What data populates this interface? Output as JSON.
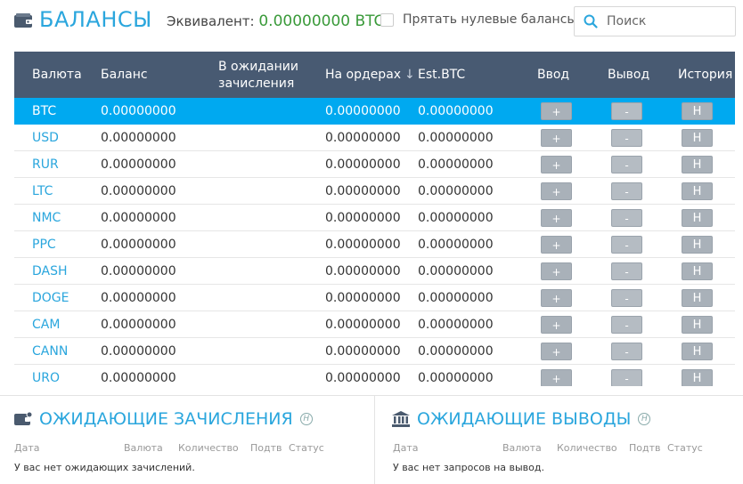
{
  "header": {
    "title": "БАЛАНСЫ",
    "equiv_label": "Эквивалент:",
    "equiv_value": "0.00000000 BTC",
    "hide_zero_label": "Прятать нулевые балансы",
    "search_placeholder": "Поиск"
  },
  "table": {
    "columns": {
      "currency": "Валюта",
      "balance": "Баланс",
      "pending_1": "В ожидании",
      "pending_2": "зачисления",
      "orders": "На ордерах",
      "sort_arrow": "↓",
      "est_btc": "Est.BTC",
      "deposit": "Ввод",
      "withdraw": "Вывод",
      "history": "История"
    },
    "button_labels": {
      "deposit": "+",
      "withdraw": "-",
      "history": "H"
    },
    "rows": [
      {
        "currency": "BTC",
        "balance": "0.00000000",
        "orders": "0.00000000",
        "est_btc": "0.00000000"
      },
      {
        "currency": "USD",
        "balance": "0.00000000",
        "orders": "0.00000000",
        "est_btc": "0.00000000"
      },
      {
        "currency": "RUR",
        "balance": "0.00000000",
        "orders": "0.00000000",
        "est_btc": "0.00000000"
      },
      {
        "currency": "LTC",
        "balance": "0.00000000",
        "orders": "0.00000000",
        "est_btc": "0.00000000"
      },
      {
        "currency": "NMC",
        "balance": "0.00000000",
        "orders": "0.00000000",
        "est_btc": "0.00000000"
      },
      {
        "currency": "PPC",
        "balance": "0.00000000",
        "orders": "0.00000000",
        "est_btc": "0.00000000"
      },
      {
        "currency": "DASH",
        "balance": "0.00000000",
        "orders": "0.00000000",
        "est_btc": "0.00000000"
      },
      {
        "currency": "DOGE",
        "balance": "0.00000000",
        "orders": "0.00000000",
        "est_btc": "0.00000000"
      },
      {
        "currency": "CAM",
        "balance": "0.00000000",
        "orders": "0.00000000",
        "est_btc": "0.00000000"
      },
      {
        "currency": "CANN",
        "balance": "0.00000000",
        "orders": "0.00000000",
        "est_btc": "0.00000000"
      },
      {
        "currency": "URO",
        "balance": "0.00000000",
        "orders": "0.00000000",
        "est_btc": "0.00000000"
      }
    ],
    "selected_row": "BTC"
  },
  "pending_deposits": {
    "title": "ОЖИДАЮЩИЕ ЗАЧИСЛЕНИЯ",
    "help": "H",
    "cols": [
      "Дата",
      "Валюта",
      "Количество",
      "Подтв",
      "Статус"
    ],
    "empty": "У вас нет ожидающих зачислений."
  },
  "pending_withdrawals": {
    "title": "ОЖИДАЮЩИЕ ВЫВОДЫ",
    "help": "H",
    "cols": [
      "Дата",
      "Валюта",
      "Количество",
      "Подтв",
      "Статус"
    ],
    "empty": "У вас нет запросов на вывод."
  },
  "colors": {
    "accent": "#2aa6dd",
    "header_bg": "#485a72",
    "selected_row": "#00a9f0",
    "equiv_green": "#3a9a3a"
  }
}
